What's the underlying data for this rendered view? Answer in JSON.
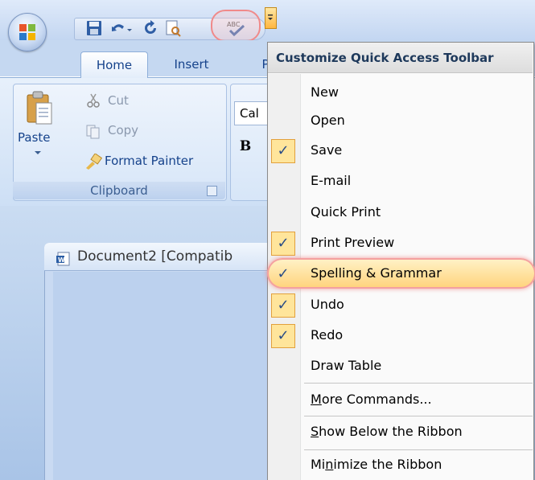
{
  "ribbon": {
    "tabs": [
      "Home",
      "Insert",
      "P"
    ],
    "clipboard": {
      "paste_label": "Paste",
      "cut_label": "Cut",
      "copy_label": "Copy",
      "format_painter_label": "Format Painter",
      "group_label": "Clipboard"
    },
    "font": {
      "font_name": "Cal",
      "bold_label": "B"
    }
  },
  "document": {
    "title": "Document2 [Compatib"
  },
  "menu": {
    "title": "Customize Quick Access Toolbar",
    "items": [
      {
        "label": "New",
        "checked": false
      },
      {
        "label": "Open",
        "checked": false
      },
      {
        "label": "Save",
        "checked": true
      },
      {
        "label": "E-mail",
        "checked": false
      },
      {
        "label": "Quick Print",
        "checked": false
      },
      {
        "label": "Print Preview",
        "checked": true
      },
      {
        "label": "Spelling & Grammar",
        "checked": true
      },
      {
        "label": "Undo",
        "checked": true
      },
      {
        "label": "Redo",
        "checked": true
      },
      {
        "label": "Draw Table",
        "checked": false
      }
    ],
    "more_commands": {
      "pre": "",
      "u": "M",
      "post": "ore Commands..."
    },
    "show_below": {
      "pre": "",
      "u": "S",
      "post": "how Below the Ribbon"
    },
    "minimize": {
      "pre": "Mi",
      "u": "n",
      "post": "imize the Ribbon"
    },
    "check_glyph": "✓"
  },
  "colors": {
    "accent": "#15428b",
    "highlight": "#ffd27a",
    "check_bg": "#ffe59b"
  }
}
